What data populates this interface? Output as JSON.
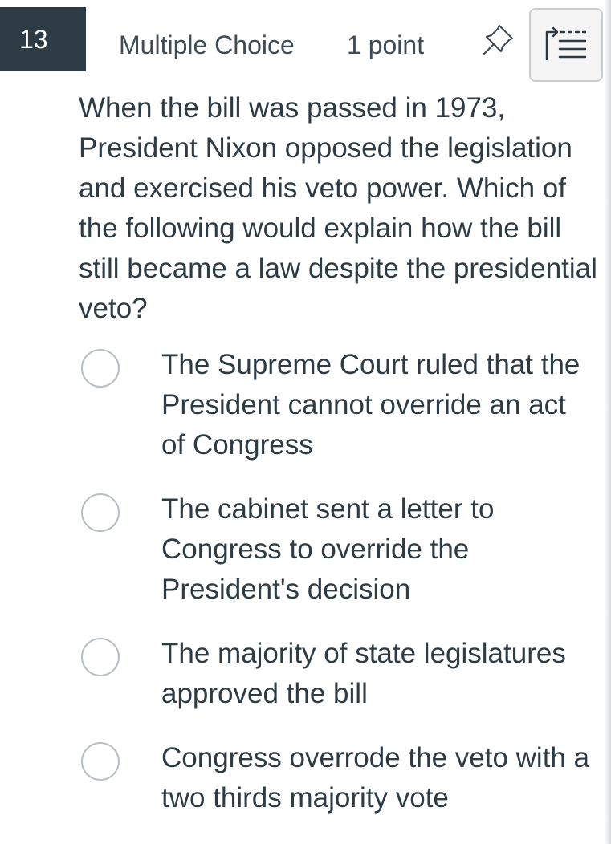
{
  "question": {
    "number": "13",
    "type": "Multiple Choice",
    "points": "1 point",
    "text": "When the bill was passed in 1973, President Nixon opposed the legislation and exercised his veto power.  Which of the following would explain how the bill still became a law despite the presidential veto?",
    "options": [
      {
        "label": "The Supreme Court ruled that the President cannot override an act of Congress"
      },
      {
        "label": "The cabinet sent a letter to Congress to override the President's decision"
      },
      {
        "label": "The majority of state legislatures approved the bill"
      },
      {
        "label": "Congress overrode the veto with a two thirds majority vote"
      }
    ]
  },
  "icons": {
    "pin": "pin-icon",
    "navigator": "question-navigator-icon"
  },
  "colors": {
    "number_badge_bg": "#2d3b45",
    "text": "#2d3b45",
    "radio_border": "#b7bec4"
  }
}
